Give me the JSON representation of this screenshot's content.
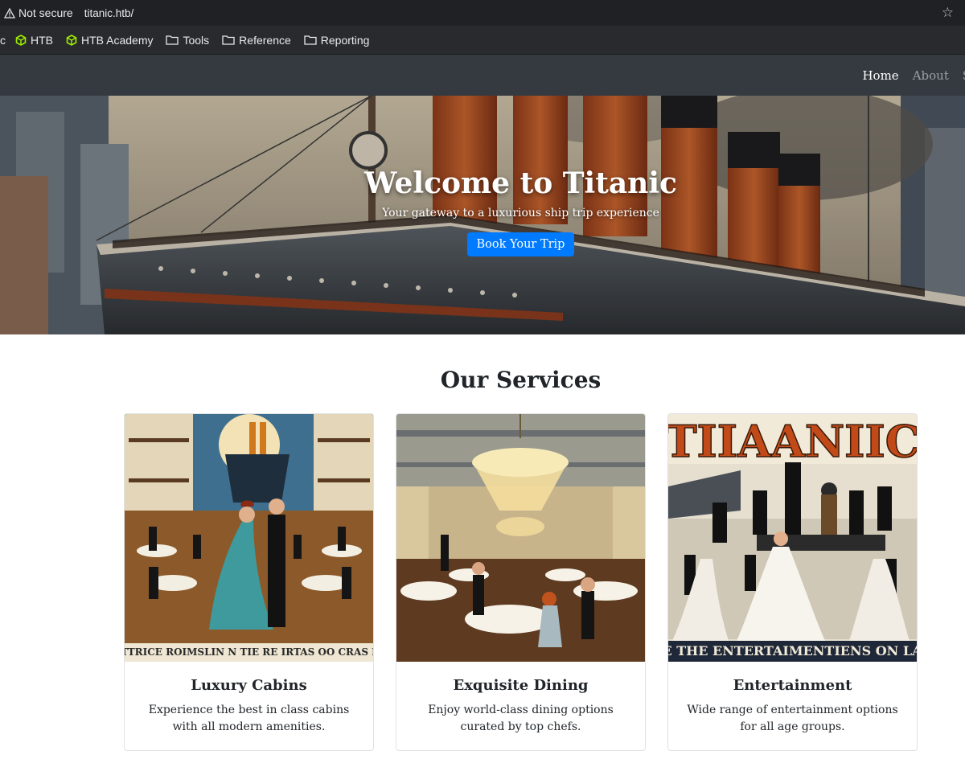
{
  "browser": {
    "security_label": "Not secure",
    "url": "titanic.htb/",
    "bookmarks": [
      {
        "label": "c",
        "icon": "cut-off-icon"
      },
      {
        "label": "HTB",
        "icon": "htb-cube-icon"
      },
      {
        "label": "HTB Academy",
        "icon": "htb-cube-icon"
      },
      {
        "label": "Tools",
        "icon": "folder-icon"
      },
      {
        "label": "Reference",
        "icon": "folder-icon"
      },
      {
        "label": "Reporting",
        "icon": "folder-icon"
      }
    ]
  },
  "nav": {
    "links": [
      {
        "label": "Home",
        "active": true
      },
      {
        "label": "About",
        "active": false
      },
      {
        "label": "Se",
        "active": false
      }
    ]
  },
  "hero": {
    "title": "Welcome to Titanic",
    "subtitle": "Your gateway to a luxurious ship trip experience",
    "button_label": "Book Your Trip"
  },
  "services": {
    "title": "Our Services",
    "cards": [
      {
        "title": "Luxury Cabins",
        "text": "Experience the best in class cabins with all modern amenities.",
        "image_caption": "TTRICE ROIMSLIN N TIE RE IRTAS OO CRAS I"
      },
      {
        "title": "Exquisite Dining",
        "text": "Enjoy world-class dining options curated by top chefs."
      },
      {
        "title": "Entertainment",
        "text": "Wide range of entertainment options for all age groups.",
        "image_heading": "TIIAANIIC",
        "image_caption": "E THE ENTERTAIMENTIENS ON LA"
      }
    ]
  },
  "colors": {
    "navbar": "#343a40",
    "primary_button": "#007bff",
    "browser_bar": "#202124",
    "bookmarks_bar": "#292a2d"
  }
}
